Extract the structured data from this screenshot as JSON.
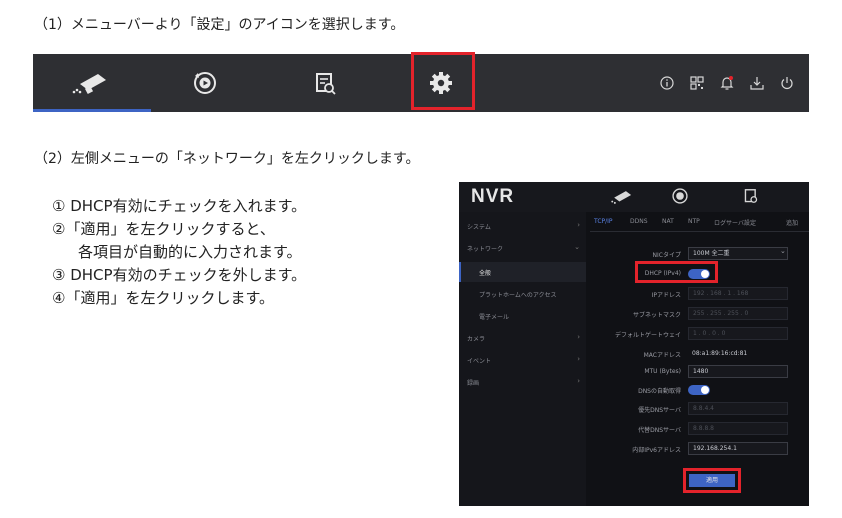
{
  "step1_text": "（1）メニューバーより「設定」のアイコンを選択します。",
  "step2_text": "（2）左側メニューの「ネットワーク」を左クリックします。",
  "steps": [
    "① DHCP有効にチェックを入れます。",
    "②「適用」を左クリックすると、",
    "各項目が自動的に入力されます。",
    "③ DHCP有効のチェックを外します。",
    "④「適用」を左クリックします。"
  ],
  "menubar": {
    "icons": [
      "camera-icon",
      "playback-icon",
      "file-search-icon",
      "settings-gear-icon"
    ],
    "right_icons": [
      "info-icon",
      "qr-icon",
      "bell-icon",
      "download-icon",
      "power-icon"
    ],
    "accent": "#3d64c4",
    "highlight": "#e3232b"
  },
  "nvr": {
    "logo": "NVR",
    "sidebar": [
      {
        "label": "システム"
      },
      {
        "label": "ネットワーク"
      },
      {
        "label": "全般"
      },
      {
        "label": "プラットホームへのアクセス"
      },
      {
        "label": "電子メール"
      },
      {
        "label": "カメラ"
      },
      {
        "label": "イベント"
      },
      {
        "label": "録画"
      }
    ],
    "tabs": [
      "TCP/IP",
      "DDNS",
      "NAT",
      "NTP",
      "ログサーバ設定",
      "追加"
    ],
    "fields": {
      "nic_label": "NICタイプ",
      "nic_value": "100M 全二重",
      "dhcp_label": "DHCP (IPv4)",
      "ip_label": "IPアドレス",
      "ip_value": "192 . 168 . 1 . 168",
      "mask_label": "サブネットマスク",
      "mask_value": "255 . 255 . 255 . 0",
      "gw_label": "デフォルトゲートウェイ",
      "gw_value": "1 . 0 . 0 . 0",
      "mac_label": "MACアドレス",
      "mac_value": "08:a1:89:16:cd:81",
      "mtu_label": "MTU (Bytes)",
      "mtu_value": "1480",
      "dns_auto_label": "DNSの自動取得",
      "dns1_label": "優先DNSサーバ",
      "dns1_value": "8.8.4.4",
      "dns2_label": "代替DNSサーバ",
      "dns2_value": "8.8.8.8",
      "ipv6_label": "内部IPv6アドレス",
      "ipv6_value": "192.168.254.1"
    },
    "apply_label": "適用"
  }
}
